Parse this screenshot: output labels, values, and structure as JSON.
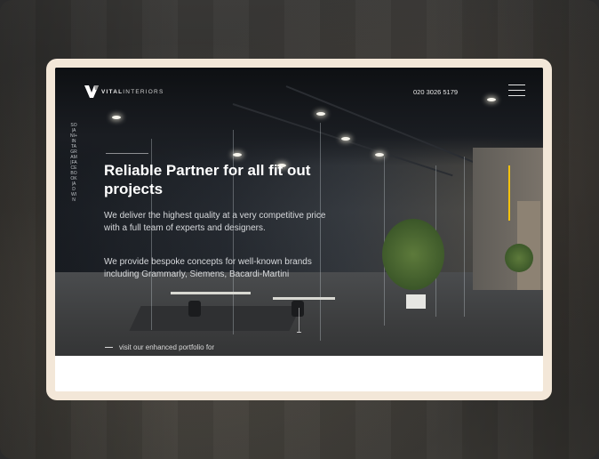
{
  "brand": {
    "logo_text_bold": "VITAL",
    "logo_text_light": "INTERIORS"
  },
  "header": {
    "phone": "020 3026 5179"
  },
  "side_social": {
    "text": "SO|ANI+IN TAGRAM|FACEBOOK|ADWIN"
  },
  "hero": {
    "heading": "Reliable Partner for all fit out projects",
    "paragraph1": "We deliver the highest quality at a very competitive price with a full team of experts and designers.",
    "paragraph2": "We provide bespoke concepts for well-known brands including Grammarly, Siemens, Bacardi-Martini",
    "portfolio_link": "visit our enhanced portfolio for"
  },
  "colors": {
    "accent": "#f4c20d",
    "frame": "#f3e7d8"
  },
  "icons": {
    "menu": "hamburger-menu-icon",
    "logo": "vital-interiors-logo-icon"
  }
}
